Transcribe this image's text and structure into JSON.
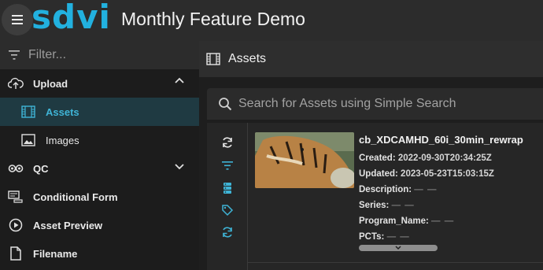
{
  "header": {
    "logo_text": "sdvi",
    "app_title": "Monthly Feature Demo",
    "menu_icon": "hamburger-icon"
  },
  "sidebar": {
    "filter_placeholder": "Filter...",
    "items": [
      {
        "label": "Upload",
        "icon": "upload-icon",
        "expanded": true
      },
      {
        "label": "Assets",
        "icon": "film-icon",
        "active": true
      },
      {
        "label": "Images",
        "icon": "image-icon"
      },
      {
        "label": "QC",
        "icon": "qc-icon",
        "expanded": false
      },
      {
        "label": "Conditional Form",
        "icon": "form-icon"
      },
      {
        "label": "Asset Preview",
        "icon": "play-circle-icon"
      },
      {
        "label": "Filename",
        "icon": "file-icon"
      }
    ]
  },
  "main": {
    "title": "Assets",
    "search_placeholder": "Search for Assets using Simple Search",
    "asset": {
      "name": "cb_XDCAMHD_60i_30min_rewrap",
      "created_label": "Created:",
      "created": "2022-09-30T20:34:25Z",
      "updated_label": "Updated:",
      "updated": "2023-05-23T15:03:15Z",
      "description_label": "Description:",
      "series_label": "Series:",
      "program_name_label": "Program_Name:",
      "pcts_label": "PCTs:",
      "empty_value": "— —"
    }
  },
  "colors": {
    "accent": "#22b1df",
    "active_bg": "#1f3a42",
    "tool_icon": "#3fb4d6"
  }
}
